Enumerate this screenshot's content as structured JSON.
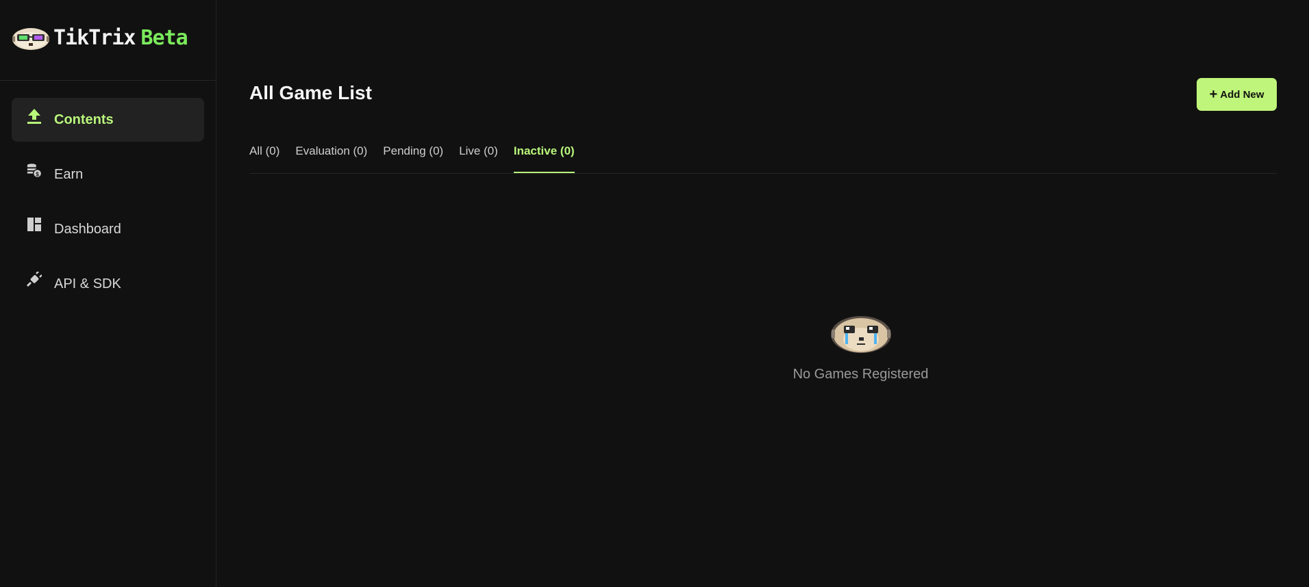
{
  "brand": {
    "name": "TikTrix",
    "tag": "Beta",
    "logo_icon": "sloth-mascot-icon"
  },
  "sidebar": {
    "items": [
      {
        "label": "Contents",
        "icon": "upload-icon",
        "active": true
      },
      {
        "label": "Earn",
        "icon": "coins-icon",
        "active": false
      },
      {
        "label": "Dashboard",
        "icon": "dashboard-icon",
        "active": false
      },
      {
        "label": "API & SDK",
        "icon": "plug-icon",
        "active": false
      }
    ]
  },
  "main": {
    "title": "All Game List",
    "add_button": {
      "icon": "plus-icon",
      "label": "Add New"
    },
    "tabs": [
      {
        "label": "All (0)",
        "active": false
      },
      {
        "label": "Evaluation (0)",
        "active": false
      },
      {
        "label": "Pending (0)",
        "active": false
      },
      {
        "label": "Live (0)",
        "active": false
      },
      {
        "label": "Inactive (0)",
        "active": true
      }
    ],
    "empty_state": {
      "icon": "crying-sloth-icon",
      "message": "No Games Registered"
    }
  },
  "colors": {
    "background": "#111111",
    "accent": "#b9f77b",
    "button_bg": "#bff57a",
    "brand_beta": "#7bea5c",
    "active_nav_bg": "#222222"
  }
}
